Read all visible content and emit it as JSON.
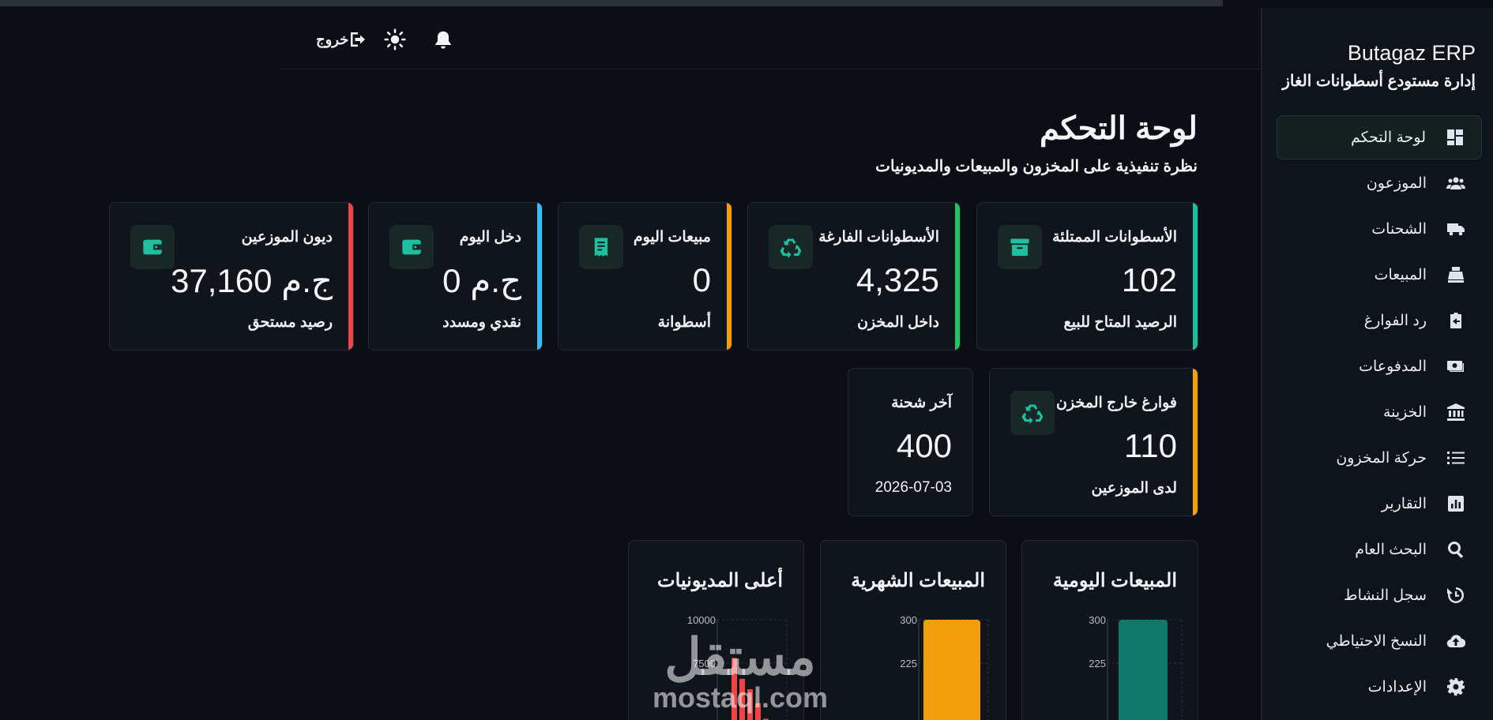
{
  "app": {
    "title": "Butagaz ERP",
    "subtitle": "إدارة مستودع أسطوانات الغاز"
  },
  "nav": {
    "items": [
      {
        "label": "لوحة التحكم",
        "icon": "dashboard-icon",
        "active": true
      },
      {
        "label": "الموزعون",
        "icon": "users-icon"
      },
      {
        "label": "الشحنات",
        "icon": "truck-icon"
      },
      {
        "label": "المبيعات",
        "icon": "cash-register-icon"
      },
      {
        "label": "رد الفوارغ",
        "icon": "return-box-icon"
      },
      {
        "label": "المدفوعات",
        "icon": "money-bill-icon"
      },
      {
        "label": "الخزينة",
        "icon": "bank-icon"
      },
      {
        "label": "حركة المخزون",
        "icon": "list-icon"
      },
      {
        "label": "التقارير",
        "icon": "chart-bar-icon"
      },
      {
        "label": "البحث العام",
        "icon": "search-icon"
      },
      {
        "label": "سجل النشاط",
        "icon": "history-icon"
      },
      {
        "label": "النسخ الاحتياطي",
        "icon": "cloud-upload-icon"
      },
      {
        "label": "الإعدادات",
        "icon": "gear-icon"
      }
    ]
  },
  "topbar": {
    "logout_label": "خروج",
    "icons": [
      "logout-icon",
      "sun-icon",
      "bell-icon"
    ]
  },
  "page": {
    "title": "لوحة التحكم",
    "subtitle": "نظرة تنفيذية على المخزون والمبيعات والمديونيات"
  },
  "cards": {
    "full_cylinders": {
      "title": "الأسطوانات الممتلئة",
      "value": "102",
      "foot": "الرصيد المتاح للبيع",
      "accent": "#1bbf9f",
      "icon": "archive-box-icon"
    },
    "empty_cylinders": {
      "title": "الأسطوانات الفارغة",
      "value": "4,325",
      "foot": "داخل المخزن",
      "accent": "#22c55e",
      "icon": "recycle-icon"
    },
    "today_sales": {
      "title": "مبيعات اليوم",
      "value": "0",
      "foot": "أسطوانة",
      "accent": "#f59e0b",
      "icon": "receipt-icon"
    },
    "today_income": {
      "title": "دخل اليوم",
      "value": "0 ج.م",
      "foot": "نقدي ومسدد",
      "accent": "#38bdf8",
      "icon": "wallet-icon"
    },
    "distributor_debts": {
      "title": "ديون الموزعين",
      "value": "37,160 ج.م",
      "foot": "رصيد مستحق",
      "accent": "#ef4444",
      "icon": "wallet-icon"
    },
    "empties_outside": {
      "title": "فوارغ خارج المخزن",
      "value": "110",
      "foot": "لدى الموزعين",
      "accent": "#f59e0b",
      "icon": "recycle-icon"
    },
    "last_shipment": {
      "title": "آخر شحنة",
      "value": "400",
      "foot": "2026-07-03"
    }
  },
  "charts": {
    "daily": {
      "title": "المبيعات اليومية",
      "bar_color": "#10786a"
    },
    "monthly": {
      "title": "المبيعات الشهرية",
      "bar_color": "#f59e0b"
    },
    "debts": {
      "title": "أعلى المديونيات",
      "bar_color": "#ef4444"
    }
  },
  "chart_data": [
    {
      "type": "bar",
      "title": "المبيعات اليومية",
      "categories": [
        ""
      ],
      "values": [
        300
      ],
      "ylim": [
        0,
        300
      ],
      "yticks": [
        "300",
        "225"
      ],
      "grid": true
    },
    {
      "type": "bar",
      "title": "المبيعات الشهرية",
      "categories": [
        ""
      ],
      "values": [
        300
      ],
      "ylim": [
        0,
        300
      ],
      "yticks": [
        "300",
        "225"
      ],
      "grid": true
    },
    {
      "type": "bar",
      "title": "أعلى المديونيات",
      "categories": [
        "",
        "",
        "",
        "",
        ""
      ],
      "values": [
        7800,
        6600,
        6000,
        5200,
        4300
      ],
      "ylim": [
        0,
        10000
      ],
      "yticks": [
        "10000",
        "7500"
      ],
      "grid": true
    }
  ],
  "watermark": {
    "arabic": "مستقل",
    "latin": "mostaql.com"
  }
}
